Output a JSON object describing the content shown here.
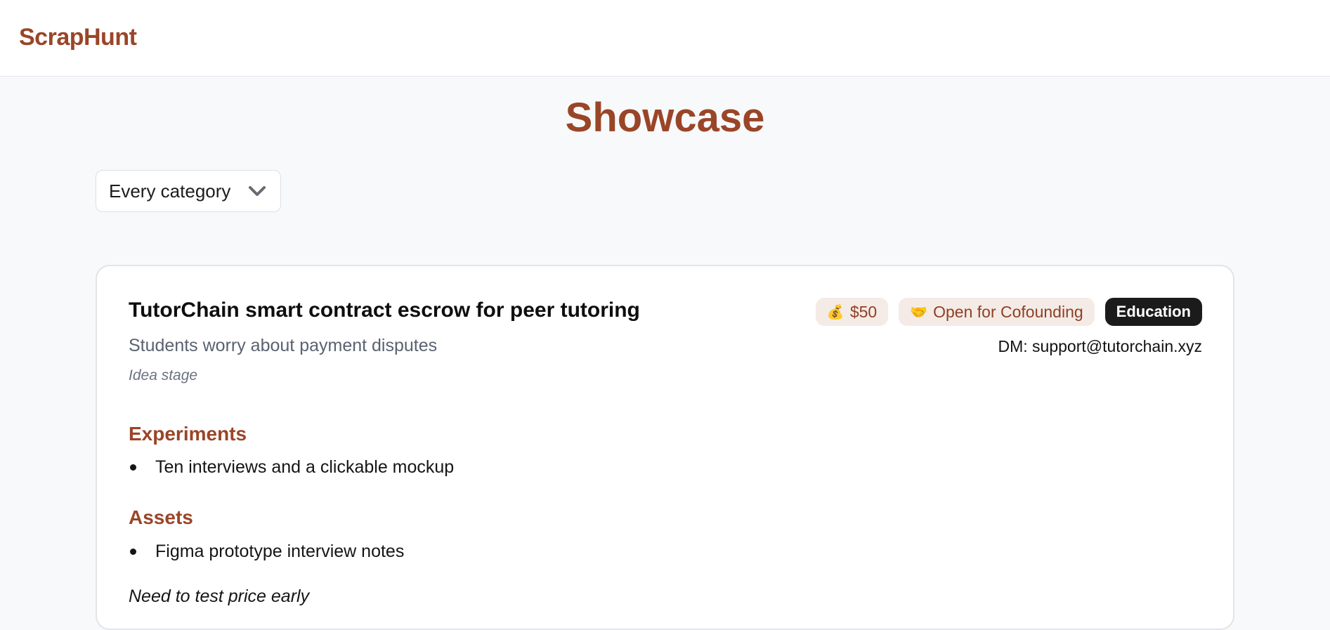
{
  "header": {
    "brand": "ScrapHunt"
  },
  "page": {
    "title": "Showcase"
  },
  "filter": {
    "category_label": "Every category",
    "chevron_icon": "chevron-down-icon"
  },
  "card": {
    "title": "TutorChain smart contract escrow for peer tutoring",
    "subtitle": "Students worry about payment disputes",
    "stage": "Idea stage",
    "badges": {
      "price": {
        "emoji": "💰",
        "label": "$50"
      },
      "cofounding": {
        "emoji": "🤝",
        "label": "Open for Cofounding"
      },
      "category": "Education"
    },
    "dm": "DM: support@tutorchain.xyz",
    "sections": {
      "experiments": {
        "title": "Experiments",
        "items": [
          "Ten interviews and a clickable mockup"
        ]
      },
      "assets": {
        "title": "Assets",
        "items": [
          "Figma prototype interview notes"
        ]
      }
    },
    "note": "Need to test price early"
  },
  "colors": {
    "brand": "#9a4528",
    "badge_soft_bg": "#f4ebe6",
    "badge_dark_bg": "#1b1b1b",
    "page_bg": "#f8f9fa"
  }
}
